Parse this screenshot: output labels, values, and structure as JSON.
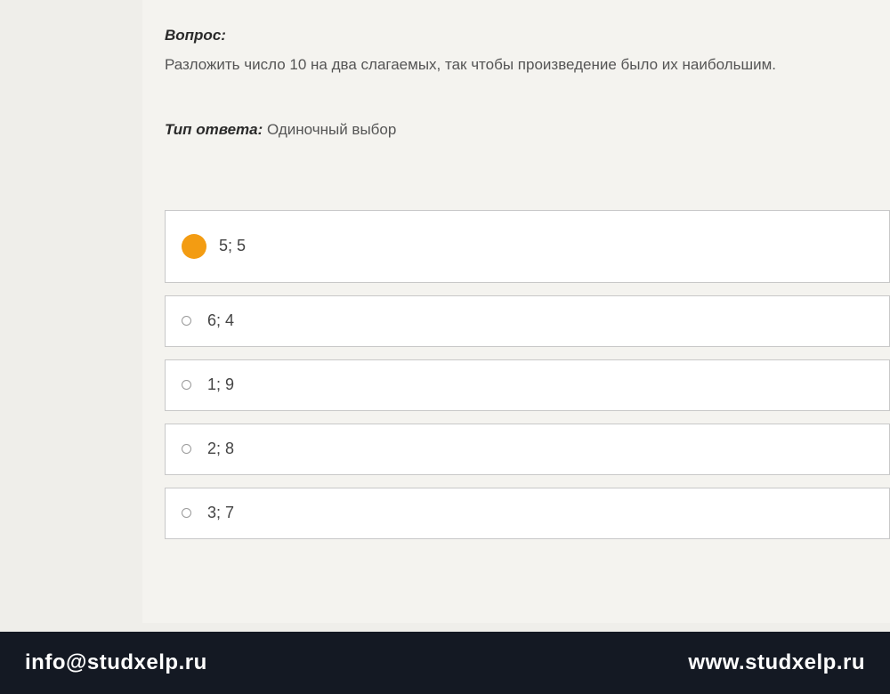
{
  "question": {
    "label": "Вопрос:",
    "text": "Разложить число 10 на два слагаемых, так чтобы произведение было их наибольшим."
  },
  "answerType": {
    "label": "Тип ответа:",
    "value": "Одиночный выбор"
  },
  "options": [
    {
      "label": "5; 5",
      "selected": true
    },
    {
      "label": "6; 4",
      "selected": false
    },
    {
      "label": "1; 9",
      "selected": false
    },
    {
      "label": "2; 8",
      "selected": false
    },
    {
      "label": "3; 7",
      "selected": false
    }
  ],
  "footer": {
    "email": "info@studxelp.ru",
    "website": "www.studxelp.ru"
  }
}
